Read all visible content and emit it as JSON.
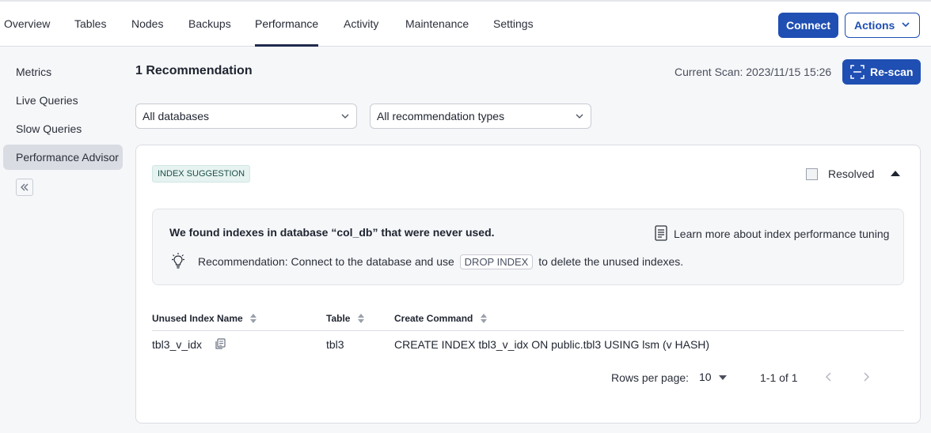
{
  "tabs": [
    {
      "label": "Overview"
    },
    {
      "label": "Tables"
    },
    {
      "label": "Nodes"
    },
    {
      "label": "Backups"
    },
    {
      "label": "Performance"
    },
    {
      "label": "Activity"
    },
    {
      "label": "Maintenance"
    },
    {
      "label": "Settings"
    }
  ],
  "active_tab": "Performance",
  "header": {
    "connect_label": "Connect",
    "actions_label": "Actions"
  },
  "sidebar": {
    "items": [
      {
        "label": "Metrics"
      },
      {
        "label": "Live Queries"
      },
      {
        "label": "Slow Queries"
      },
      {
        "label": "Performance Advisor"
      }
    ],
    "active_item": "Performance Advisor"
  },
  "main": {
    "title": "1 Recommendation",
    "scan_label": "Current Scan: 2023/11/15 15:26",
    "rescan_label": "Re-scan",
    "db_filter": "All databases",
    "type_filter": "All recommendation types"
  },
  "card": {
    "badge": "INDEX SUGGESTION",
    "resolved_label": "Resolved",
    "resolved_checked": false,
    "info_title": "We found indexes in database “col_db” that were never used.",
    "learn_more": "Learn more about index performance tuning",
    "reco_prefix": "Recommendation: Connect to the database and use",
    "reco_code": "DROP INDEX",
    "reco_suffix": "to delete the unused indexes.",
    "columns": [
      "Unused Index Name",
      "Table",
      "Create Command"
    ],
    "rows": [
      {
        "index": "tbl3_v_idx",
        "table": "tbl3",
        "command": "CREATE INDEX tbl3_v_idx ON public.tbl3 USING lsm (v HASH)"
      }
    ],
    "pagination": {
      "rows_per_page_label": "Rows per page:",
      "rows_per_page": "10",
      "range": "1-1 of 1"
    }
  }
}
